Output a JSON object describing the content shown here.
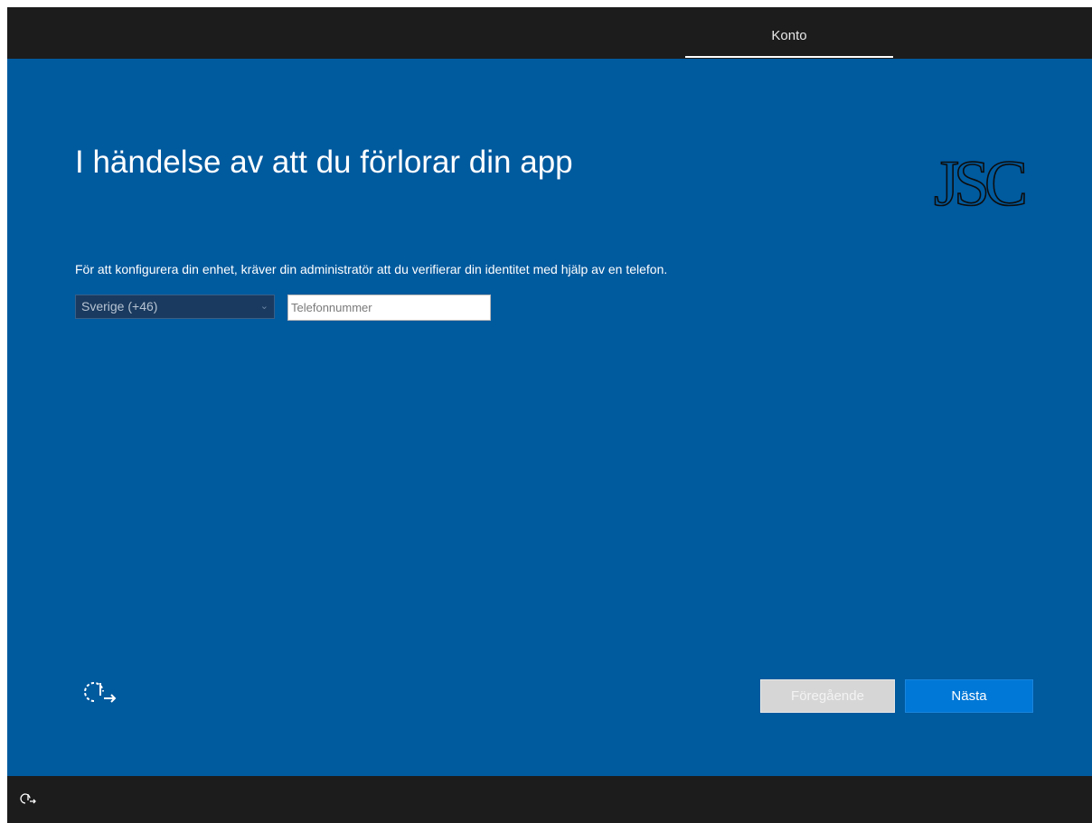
{
  "header": {
    "active_tab": "Konto"
  },
  "page": {
    "title": "I händelse av att du förlorar din app",
    "description": "För att konfigurera din enhet, kräver din administratör att du verifierar din identitet med hjälp av en telefon."
  },
  "logo": {
    "text": "JSC"
  },
  "form": {
    "country_value": "Sverige (+46)",
    "phone_placeholder": "Telefonnummer",
    "phone_value": ""
  },
  "footer": {
    "prev_label": "Föregående",
    "next_label": "Nästa"
  },
  "icons": {
    "accessibility": "ease-of-access-icon",
    "bottom": "ease-of-access-icon",
    "select_chevron": "chevron-down-icon"
  },
  "colors": {
    "background": "#005a9e",
    "bar": "#1c1c1c",
    "primary_button": "#0078d7",
    "disabled_button": "#d6d6d6"
  }
}
